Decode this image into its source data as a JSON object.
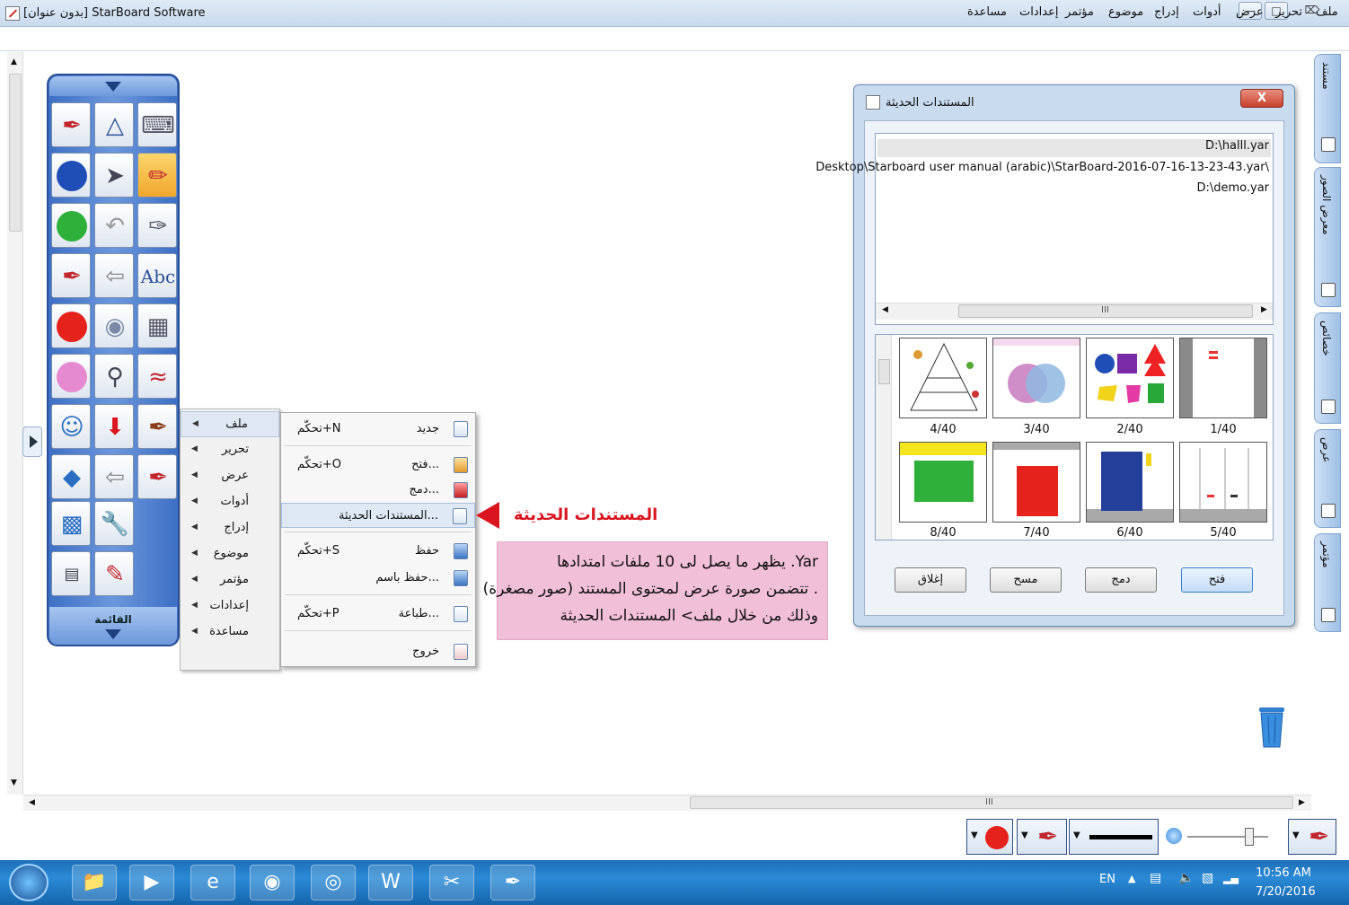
{
  "window": {
    "title": "[بدون عنوان] StarBoard Software"
  },
  "menubar": {
    "items": [
      "ملف",
      "تحرير",
      "عرض",
      "أدوات",
      "إدراج",
      "موضوع",
      "مؤتمر",
      "إعدادات",
      "مساعدة"
    ]
  },
  "side_tabs": [
    "مستند",
    "معرض الصور",
    "خصائص",
    "عرض",
    "مؤتمر"
  ],
  "toolbox": {
    "menu_label": "القائمة",
    "pen_text_label": "Abc"
  },
  "submenu": {
    "items": [
      "ملف",
      "تحرير",
      "عرض",
      "أدوات",
      "إدراج",
      "موضوع",
      "مؤتمر",
      "إعدادات",
      "مساعدة"
    ]
  },
  "file_menu": {
    "items": [
      {
        "label": "جديد",
        "shortcut": "تحكّم+N"
      },
      {
        "label": "فتح...",
        "shortcut": "تحكّم+O"
      },
      {
        "label": "دمج...",
        "shortcut": ""
      },
      {
        "label": "المستندات الحديثة...",
        "shortcut": ""
      },
      {
        "label": "حفظ",
        "shortcut": "تحكّم+S"
      },
      {
        "label": "حفظ باسم...",
        "shortcut": ""
      },
      {
        "label": "طباعة...",
        "shortcut": "تحكّم+P"
      },
      {
        "label": "خروج",
        "shortcut": ""
      }
    ]
  },
  "annotation": {
    "title": "المستندات الحديثة",
    "lines": [
      "يظهر ما يصل لى 10 ملفات امتدادها .Yar",
      "تتضمن صورة عرض لمحتوى المستند (صور مصغرة) .",
      "وذلك من خلال ملف> المستندات الحديثة"
    ]
  },
  "dialog": {
    "title": "المستندات الحديثة",
    "close_label": "X",
    "files": [
      "D:\\halll.yar",
      "Desktop\\Starboard user manual (arabic)\\StarBoard-2016-07-16-13-23-43.yar\\",
      "D:\\demo.yar"
    ],
    "scroll_marker": "III",
    "thumbnails": [
      "4/40",
      "3/40",
      "2/40",
      "1/40",
      "8/40",
      "7/40",
      "6/40",
      "5/40"
    ],
    "buttons": {
      "close": "إغلاق",
      "clear": "مسح",
      "merge": "دمج",
      "open": "فتح"
    }
  },
  "canvas": {
    "hscroll_marker": "III"
  },
  "taskbar": {
    "language": "EN",
    "time": "10:56 AM",
    "date": "7/20/2016"
  },
  "colors": {
    "accent_red": "#d9151f",
    "annotation_bg": "#f1bfd8",
    "toolbox_blue": "#3d6fc4"
  }
}
